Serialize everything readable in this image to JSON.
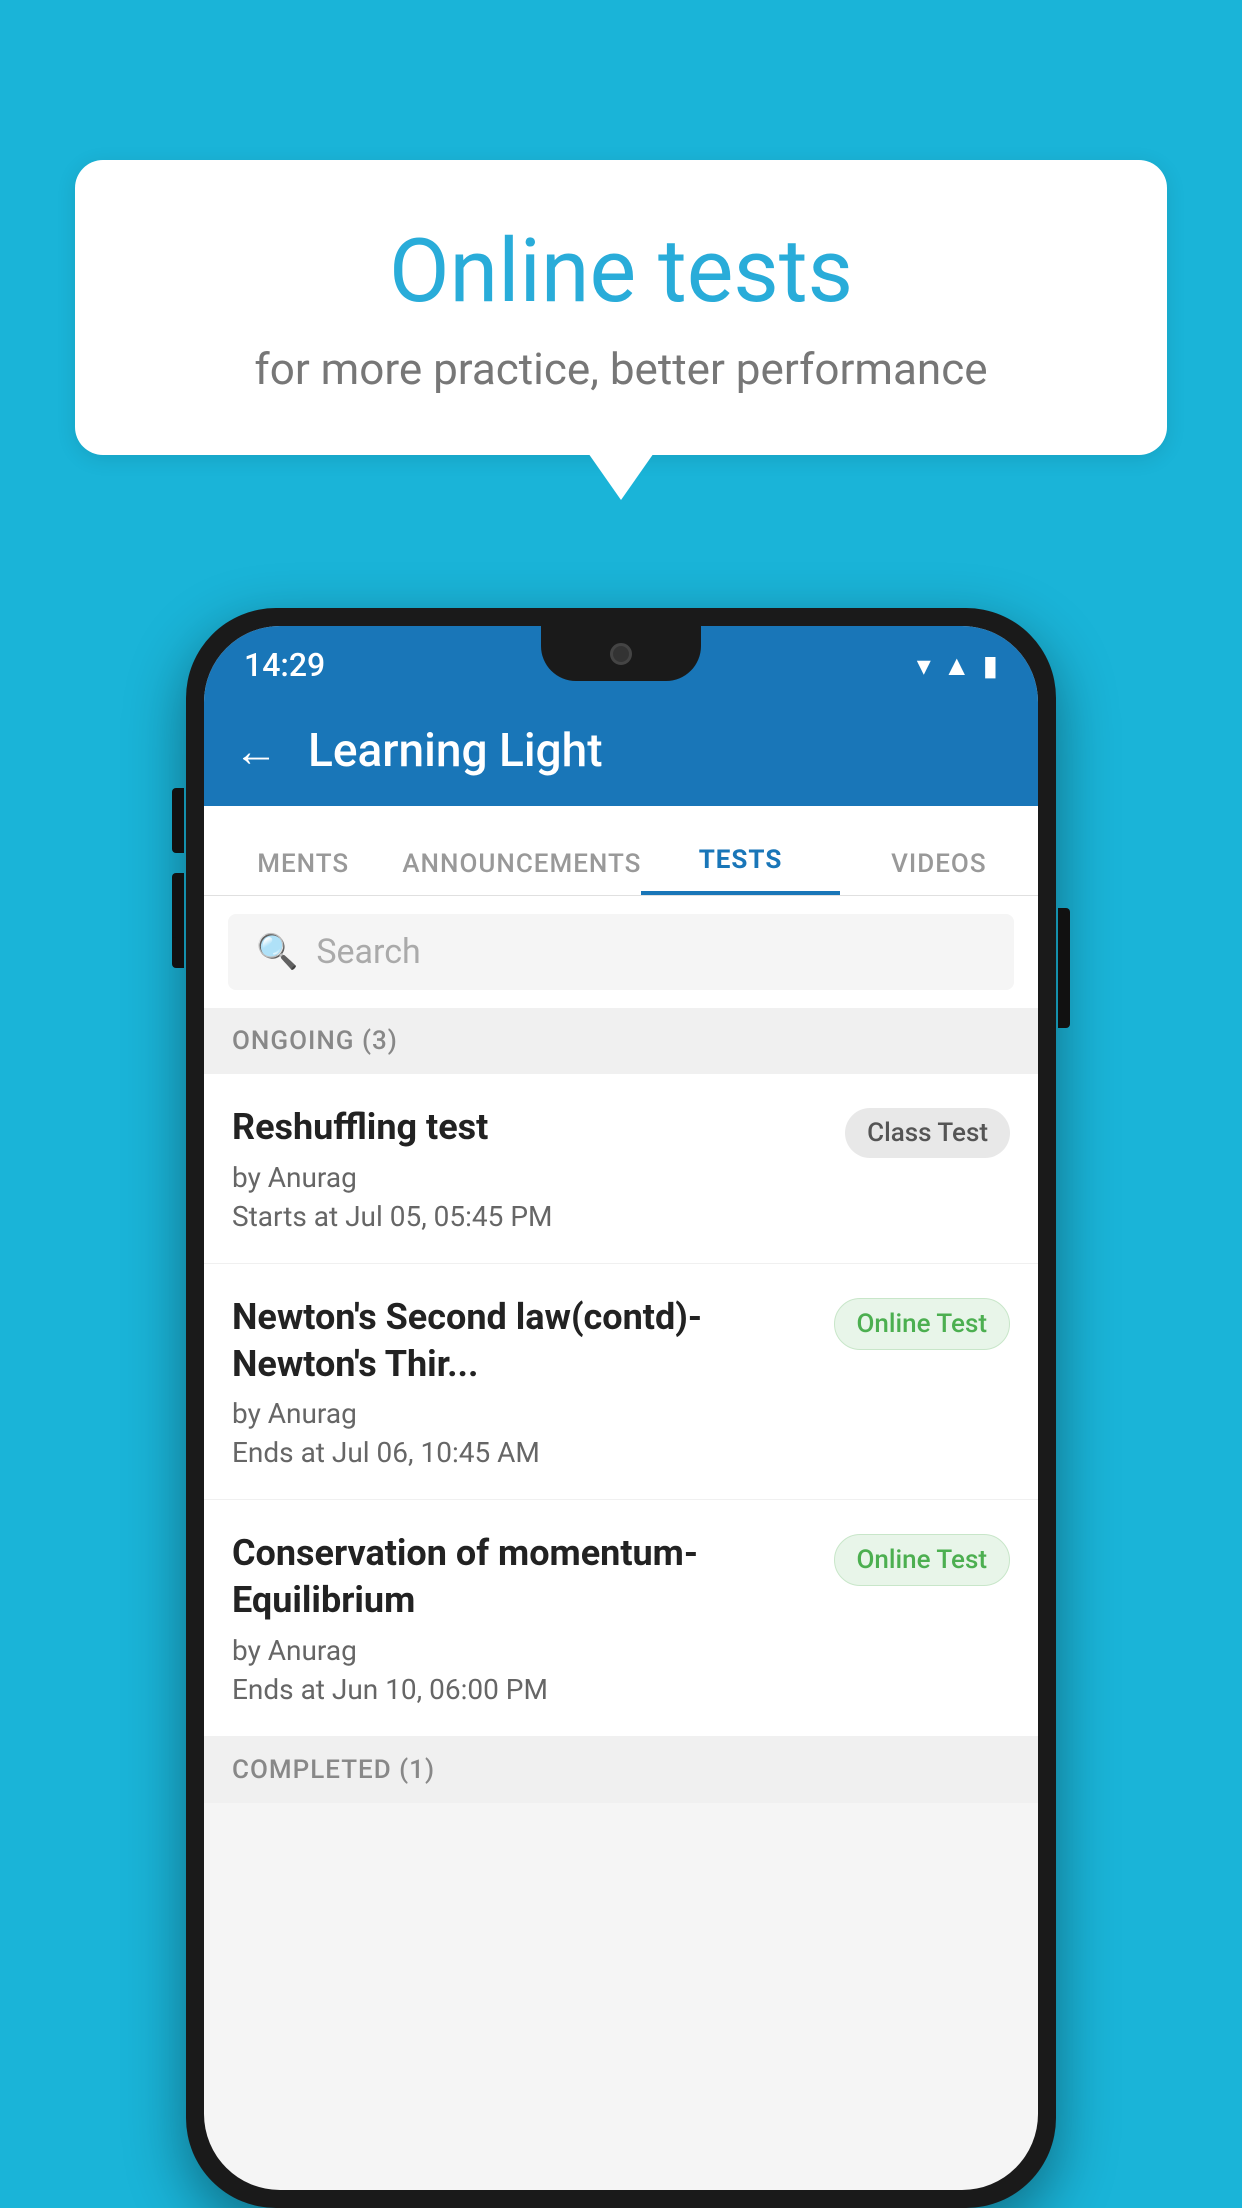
{
  "background_color": "#1ab4d8",
  "bubble": {
    "title": "Online tests",
    "subtitle": "for more practice, better performance"
  },
  "phone": {
    "status_bar": {
      "time": "14:29"
    },
    "app_bar": {
      "title": "Learning Light",
      "back_label": "←"
    },
    "tabs": [
      {
        "label": "MENTS",
        "active": false
      },
      {
        "label": "ANNOUNCEMENTS",
        "active": false
      },
      {
        "label": "TESTS",
        "active": true
      },
      {
        "label": "VIDEOS",
        "active": false
      }
    ],
    "search": {
      "placeholder": "Search"
    },
    "sections": [
      {
        "label": "ONGOING (3)",
        "tests": [
          {
            "name": "Reshuffling test",
            "by": "by Anurag",
            "date": "Starts at  Jul 05, 05:45 PM",
            "badge": "Class Test",
            "badge_type": "class"
          },
          {
            "name": "Newton's Second law(contd)-Newton's Thir...",
            "by": "by Anurag",
            "date": "Ends at  Jul 06, 10:45 AM",
            "badge": "Online Test",
            "badge_type": "online"
          },
          {
            "name": "Conservation of momentum-Equilibrium",
            "by": "by Anurag",
            "date": "Ends at  Jun 10, 06:00 PM",
            "badge": "Online Test",
            "badge_type": "online"
          }
        ]
      },
      {
        "label": "COMPLETED (1)",
        "tests": []
      }
    ]
  }
}
